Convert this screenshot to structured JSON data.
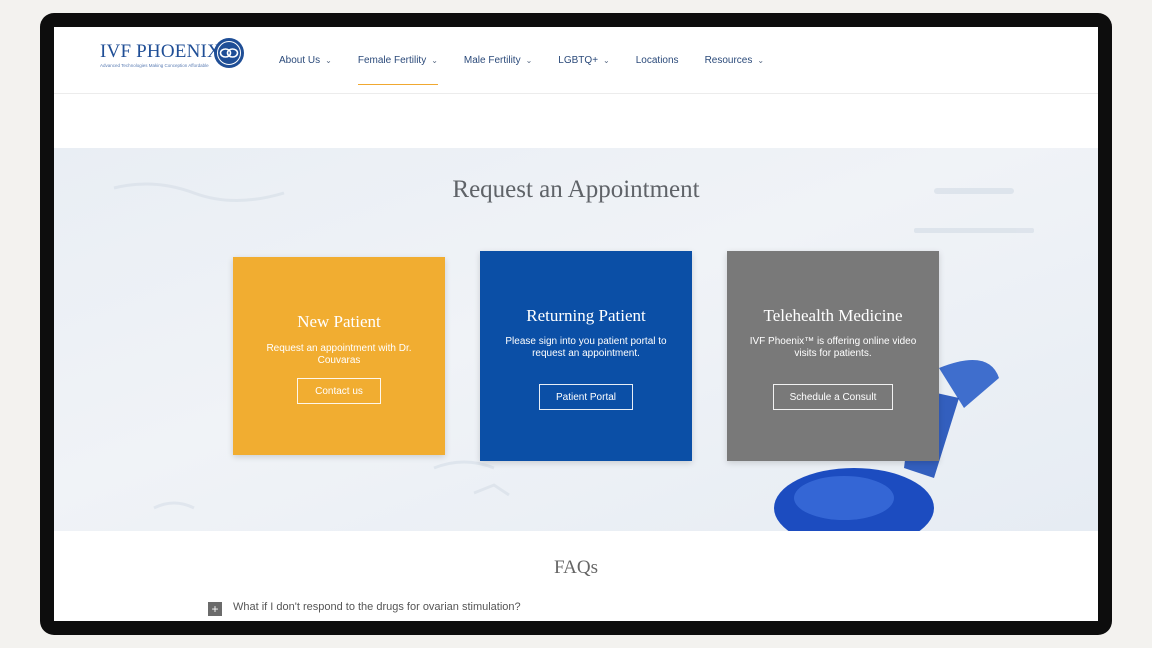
{
  "brand": {
    "name": "IVF PHOENIX",
    "trademark": "®",
    "tagline": "Advanced Technologies Making Conception Affordable",
    "primary_color": "#1f4e96"
  },
  "nav": {
    "items": [
      {
        "label": "About Us",
        "has_dropdown": true,
        "active": false
      },
      {
        "label": "Female Fertility",
        "has_dropdown": true,
        "active": true
      },
      {
        "label": "Male Fertility",
        "has_dropdown": true,
        "active": false
      },
      {
        "label": "LGBTQ+",
        "has_dropdown": true,
        "active": false
      },
      {
        "label": "Locations",
        "has_dropdown": false,
        "active": false
      },
      {
        "label": "Resources",
        "has_dropdown": true,
        "active": false
      }
    ],
    "dropdown_icon": "chevron-down-icon",
    "active_underline_color": "#f0a830"
  },
  "hero": {
    "title": "Request an Appointment",
    "cards": [
      {
        "title": "New Patient",
        "text": "Request an appointment with Dr. Couvaras",
        "button": "Contact us",
        "color": "#f1ad31"
      },
      {
        "title": "Returning Patient",
        "text": "Please sign into you patient portal to request an appointment.",
        "button": "Patient Portal",
        "color": "#0b4fa6"
      },
      {
        "title": "Telehealth Medicine",
        "text": "IVF Phoenix™ is offering online video visits for patients.",
        "button": "Schedule a Consult",
        "color": "#797979"
      }
    ]
  },
  "faq": {
    "title": "FAQs",
    "items": [
      {
        "question": "What if I don't respond to the drugs for ovarian stimulation?",
        "icon": "plus-icon"
      }
    ]
  }
}
